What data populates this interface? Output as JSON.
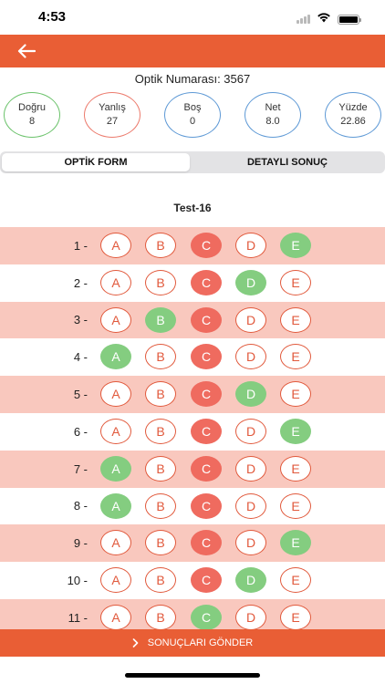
{
  "status_bar": {
    "time": "4:53"
  },
  "header": {
    "back_icon": "arrow-left-icon"
  },
  "optik_number_text": "Optik Numarası: 3567",
  "stats": [
    {
      "label": "Doğru",
      "value": "8",
      "color": "#6cc36c"
    },
    {
      "label": "Yanlış",
      "value": "27",
      "color": "#ec7b6d"
    },
    {
      "label": "Boş",
      "value": "0",
      "color": "#5f9ad6"
    },
    {
      "label": "Net",
      "value": "8.0",
      "color": "#5f9ad6"
    },
    {
      "label": "Yüzde",
      "value": "22.86",
      "color": "#5f9ad6"
    }
  ],
  "tabs": {
    "optik_form": "OPTİK FORM",
    "detayli_sonuc": "DETAYLI SONUÇ"
  },
  "test_title": "Test-16",
  "choices": [
    "A",
    "B",
    "C",
    "D",
    "E"
  ],
  "questions": [
    {
      "number": "1 -",
      "wrong": "C",
      "correct": "E"
    },
    {
      "number": "2 -",
      "wrong": "C",
      "correct": "D"
    },
    {
      "number": "3 -",
      "wrong": "C",
      "correct": "B"
    },
    {
      "number": "4 -",
      "wrong": "C",
      "correct": "A"
    },
    {
      "number": "5 -",
      "wrong": "C",
      "correct": "D"
    },
    {
      "number": "6 -",
      "wrong": "C",
      "correct": "E"
    },
    {
      "number": "7 -",
      "wrong": "C",
      "correct": "A"
    },
    {
      "number": "8 -",
      "wrong": "C",
      "correct": "A"
    },
    {
      "number": "9 -",
      "wrong": "C",
      "correct": "E"
    },
    {
      "number": "10 -",
      "wrong": "C",
      "correct": "D"
    },
    {
      "number": "11 -",
      "wrong": "",
      "correct": "C"
    }
  ],
  "submit": {
    "label": "SONUÇLARI GÖNDER",
    "icon": "chevron-right-icon"
  },
  "colors": {
    "accent": "#e95e35",
    "row_tint": "#f9c8be",
    "correct": "#84cd80",
    "wrong": "#ef6b5f"
  }
}
